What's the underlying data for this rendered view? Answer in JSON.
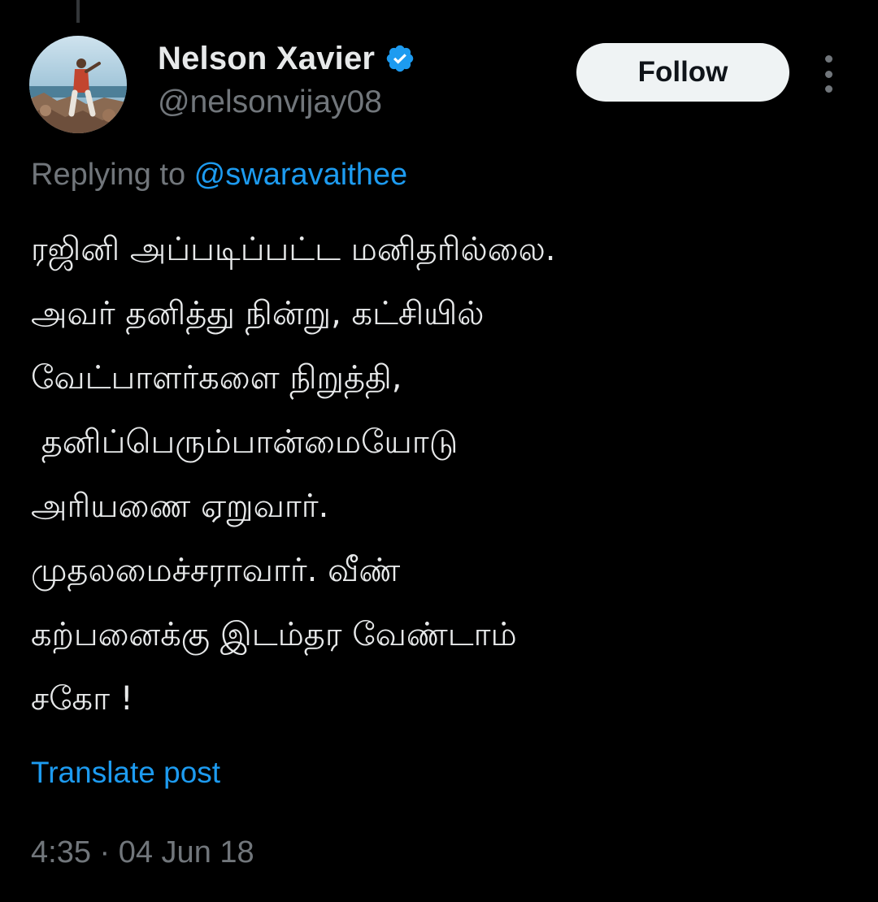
{
  "author": {
    "display_name": "Nelson Xavier",
    "handle": "@nelsonvijay08",
    "verified_icon": "verified-badge-icon",
    "avatar": "profile-photo"
  },
  "actions": {
    "follow_label": "Follow",
    "more_icon": "more-vertical-icon"
  },
  "reply": {
    "prefix": "Replying to ",
    "mention": "@swaravaithee"
  },
  "post": {
    "lines": [
      "ரஜினி அப்படிப்பட்ட மனிதரில்லை.",
      "அவர் தனித்து நின்று, கட்சியில்",
      "வேட்பாளர்களை நிறுத்தி,",
      " தனிப்பெரும்பான்மையோடு",
      "அரியணை ஏறுவார்.",
      "முதலமைச்சராவார். வீண்",
      "கற்பனைக்கு இடம்தர வேண்டாம்",
      "சகோ !"
    ],
    "translate_label": "Translate post",
    "timestamp": "4:35 · 04 Jun 18"
  },
  "colors": {
    "background": "#000000",
    "text_primary": "#e7e9ea",
    "text_secondary": "#71767b",
    "accent": "#1d9bf0",
    "button_bg": "#eff3f4",
    "button_text": "#0f1419"
  }
}
